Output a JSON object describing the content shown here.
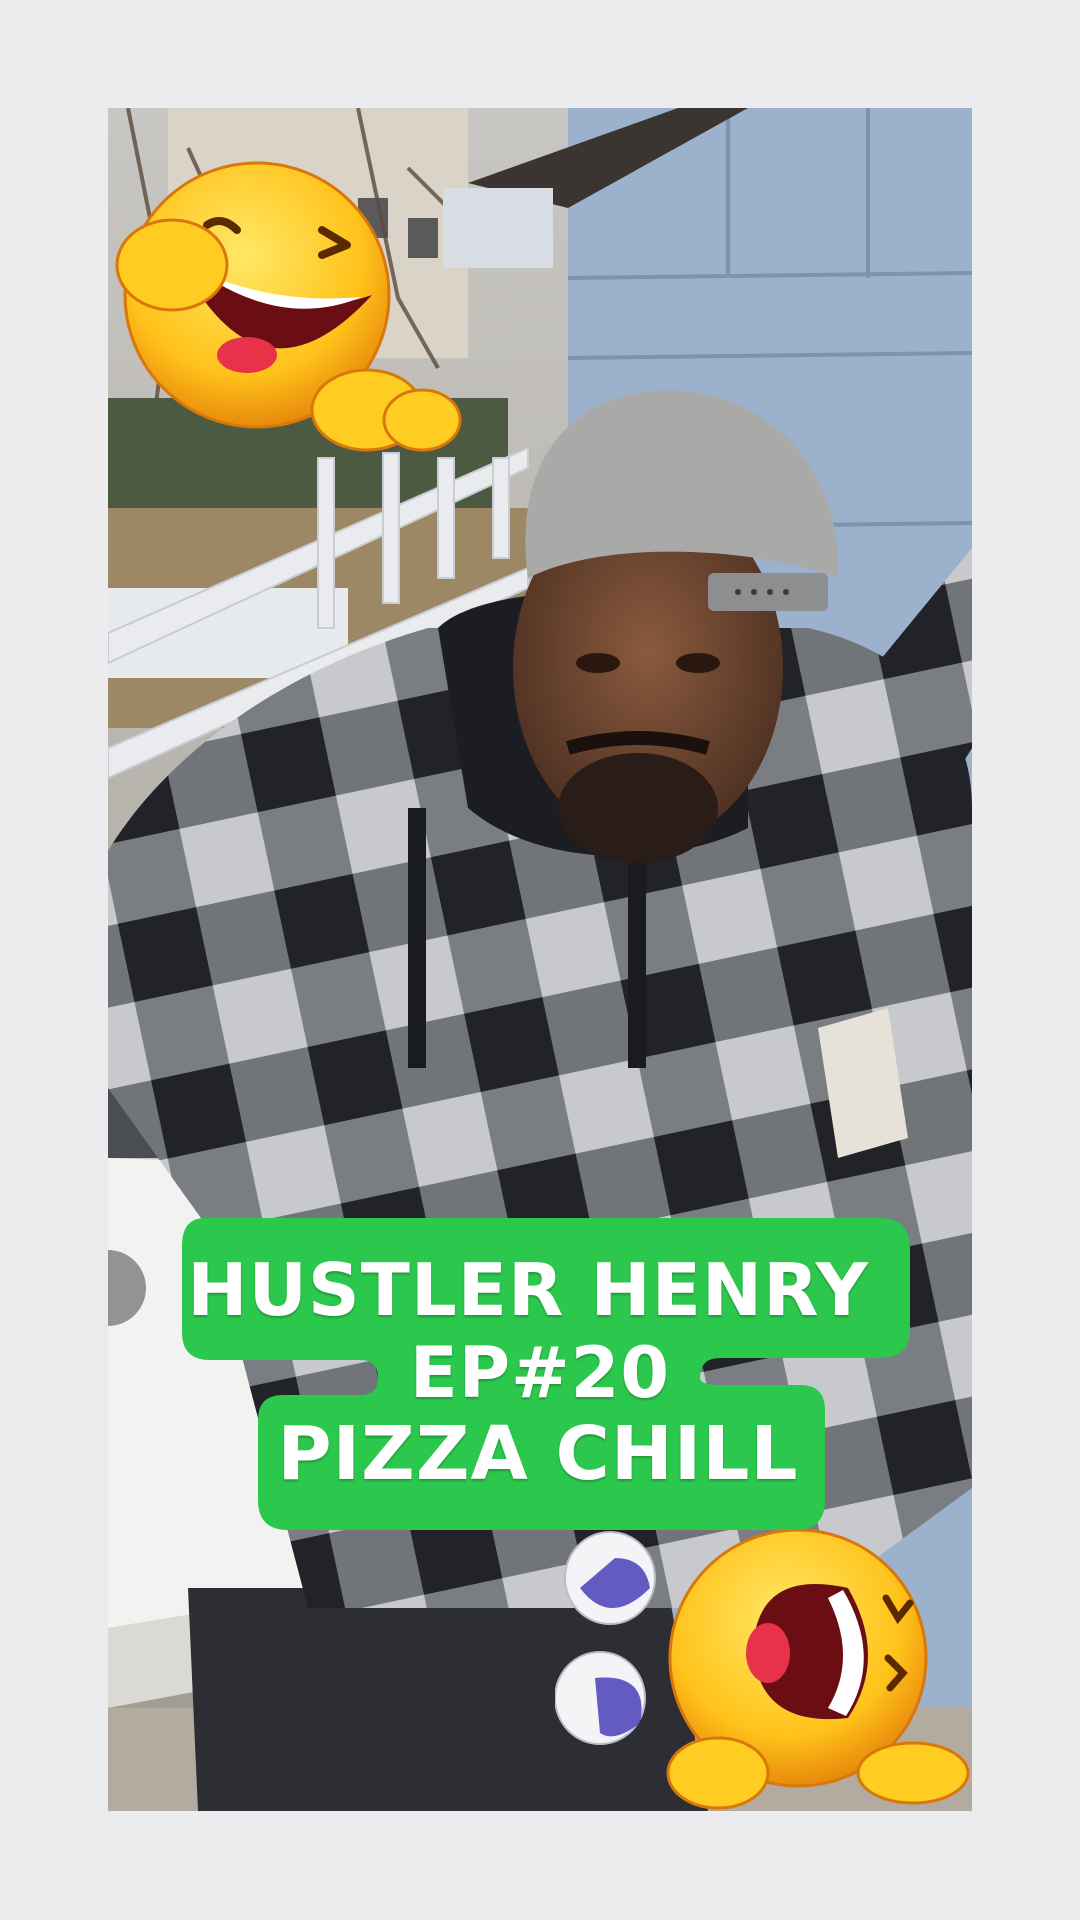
{
  "caption": {
    "line1": "HUSTLER HENRY",
    "line2": "EP#20",
    "line3": "PIZZA CHILL"
  },
  "colors": {
    "caption_green": "#2cc84d",
    "caption_text": "#ffffff",
    "page_background": "#ececee"
  },
  "stickers": {
    "top_left": "laughing-pointing-emoji",
    "bottom_right": "laughing-crying-emoji",
    "bottom_middle": "tear-drops"
  }
}
